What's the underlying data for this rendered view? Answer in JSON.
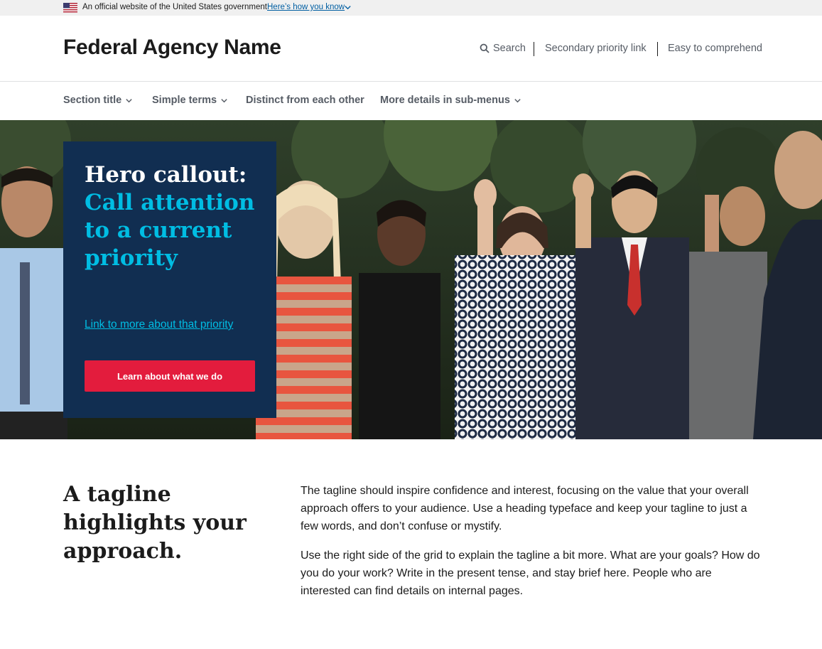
{
  "gov_banner": {
    "text": "An official website of the United States government",
    "link": "Here’s how you know"
  },
  "header": {
    "agency_name": "Federal Agency Name",
    "search_label": "Search",
    "secondary_link": "Secondary priority link",
    "easy_link": "Easy to comprehend"
  },
  "nav": {
    "items": [
      {
        "label": "Section title"
      },
      {
        "label": "Simple terms"
      },
      {
        "label": "Distinct from each other"
      },
      {
        "label": "More details in sub-menus"
      }
    ]
  },
  "hero": {
    "heading_white": "Hero callout:",
    "heading_blue": [
      "Call attention",
      "to a current",
      "priority"
    ],
    "link": "Link to more about that priority",
    "button": "Learn about what we do"
  },
  "tagline": {
    "heading": "A tagline highlights your approach.",
    "paragraph1": "The tagline should inspire confidence and interest, focusing on the value that your overall approach offers to your audience. Use a heading typeface and keep your tagline to just a few words, and don’t confuse or mystify.",
    "paragraph2": "Use the right side of the grid to explain the tagline a bit more. What are your goals? How do you do your work? Write in the present tense, and stay brief here. People who are interested can find details on internal pages."
  },
  "colors": {
    "callout_bg": "#112e51",
    "callout_accent": "#00bde3",
    "button_red": "#e31c3d",
    "link_blue": "#005ea2"
  }
}
